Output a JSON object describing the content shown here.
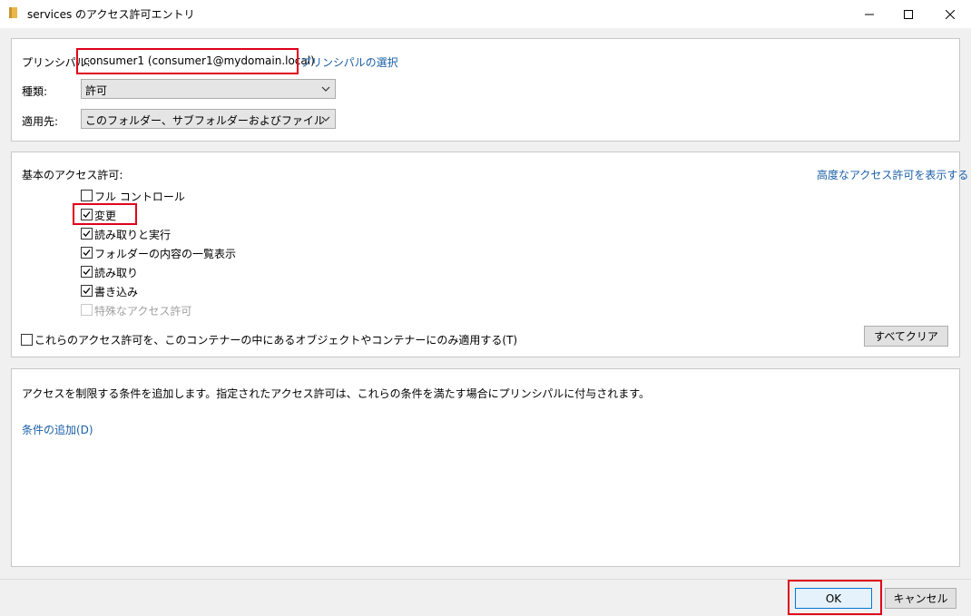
{
  "window": {
    "title": "services のアクセス許可エントリ"
  },
  "principal": {
    "label": "プリンシパル:",
    "value": "consumer1 (consumer1@mydomain.local)",
    "select_link": "プリンシパルの選択"
  },
  "type": {
    "label": "種類:",
    "value": "許可"
  },
  "applies_to": {
    "label": "適用先:",
    "value": "このフォルダー、サブフォルダーおよびファイル"
  },
  "basic": {
    "heading": "基本のアクセス許可:",
    "advanced_link": "高度なアクセス許可を表示する",
    "items": [
      {
        "label": "フル コントロール",
        "checked": false,
        "disabled": false
      },
      {
        "label": "変更",
        "checked": true,
        "disabled": false
      },
      {
        "label": "読み取りと実行",
        "checked": true,
        "disabled": false
      },
      {
        "label": "フォルダーの内容の一覧表示",
        "checked": true,
        "disabled": false
      },
      {
        "label": "読み取り",
        "checked": true,
        "disabled": false
      },
      {
        "label": "書き込み",
        "checked": true,
        "disabled": false
      },
      {
        "label": "特殊なアクセス許可",
        "checked": false,
        "disabled": true
      }
    ],
    "apply_only_label": "これらのアクセス許可を、このコンテナーの中にあるオブジェクトやコンテナーにのみ適用する(T)",
    "clear_all": "すべてクリア"
  },
  "conditions": {
    "description": "アクセスを制限する条件を追加します。指定されたアクセス許可は、これらの条件を満たす場合にプリンシパルに付与されます。",
    "add_link": "条件の追加(D)"
  },
  "footer": {
    "ok": "OK",
    "cancel": "キャンセル"
  },
  "colors": {
    "accent": "#1a5fa8",
    "highlight": "#e0001b"
  }
}
